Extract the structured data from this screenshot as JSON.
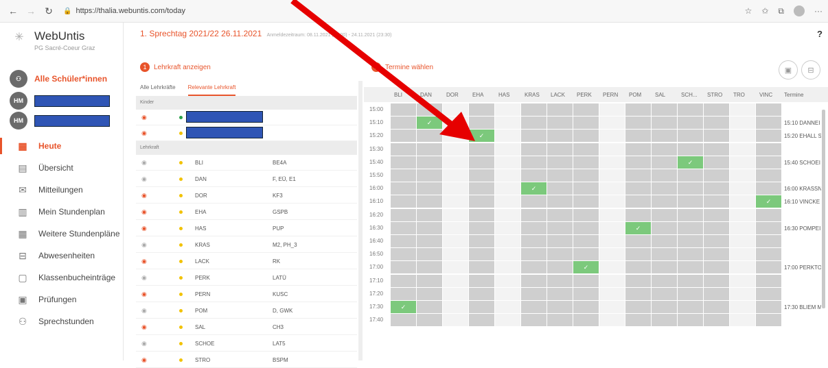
{
  "browser": {
    "url": "https://thalia.webuntis.com/today"
  },
  "app": {
    "brand": "WebUntis",
    "school": "PG Sacré-Coeur Graz"
  },
  "user": {
    "all_students": "Alle Schüler*innen",
    "initials": "HM"
  },
  "nav": [
    {
      "label": "Heute",
      "icon": "calendar-grid-icon",
      "glyph": "▦"
    },
    {
      "label": "Übersicht",
      "icon": "overview-icon",
      "glyph": "▤"
    },
    {
      "label": "Mitteilungen",
      "icon": "mail-icon",
      "glyph": "✉"
    },
    {
      "label": "Mein Stundenplan",
      "icon": "timetable-icon",
      "glyph": "▥"
    },
    {
      "label": "Weitere Stundenpläne",
      "icon": "timetables-icon",
      "glyph": "▦"
    },
    {
      "label": "Abwesenheiten",
      "icon": "absence-icon",
      "glyph": "⊟"
    },
    {
      "label": "Klassenbucheinträge",
      "icon": "classbook-icon",
      "glyph": "▢"
    },
    {
      "label": "Prüfungen",
      "icon": "exam-icon",
      "glyph": "▣"
    },
    {
      "label": "Sprechstunden",
      "icon": "consultation-icon",
      "glyph": "⚇"
    }
  ],
  "header": {
    "title": "1. Sprechtag 2021/22 26.11.2021",
    "subtitle": "Anmeldezeitraum: 08.11.2021 (00:00) - 24.11.2021 (23:30)"
  },
  "steps": {
    "step1": "Lehrkraft anzeigen",
    "step1_num": "1",
    "step2": "Termine wählen",
    "step2_num": "2"
  },
  "tabs": [
    "Alle Lehrkräfte",
    "Relevante Lehrkraft"
  ],
  "sections": {
    "kids": "Kinder",
    "teachers": "Lehrkraft"
  },
  "kids": [
    {
      "eye": "red",
      "dot": "green"
    },
    {
      "eye": "red",
      "dot": "yellow"
    }
  ],
  "teachers": [
    {
      "name": "BLI",
      "subject": "BE4A",
      "eye": "gray"
    },
    {
      "name": "DAN",
      "subject": "F, EÜ, E1",
      "eye": "gray"
    },
    {
      "name": "DOR",
      "subject": "KF3",
      "eye": "red"
    },
    {
      "name": "EHA",
      "subject": "GSPB",
      "eye": "red"
    },
    {
      "name": "HAS",
      "subject": "PUP",
      "eye": "red"
    },
    {
      "name": "KRAS",
      "subject": "M2, PH_3",
      "eye": "gray"
    },
    {
      "name": "LACK",
      "subject": "RK",
      "eye": "red"
    },
    {
      "name": "PERK",
      "subject": "LATÜ",
      "eye": "gray"
    },
    {
      "name": "PERN",
      "subject": "KUSC",
      "eye": "red"
    },
    {
      "name": "POM",
      "subject": "D, GWK",
      "eye": "gray"
    },
    {
      "name": "SAL",
      "subject": "CH3",
      "eye": "red"
    },
    {
      "name": "SCHOE",
      "subject": "LAT5",
      "eye": "gray"
    },
    {
      "name": "STRO",
      "subject": "BSPM",
      "eye": "red"
    }
  ],
  "grid": {
    "columns": [
      "BLI",
      "DAN",
      "DOR",
      "EHA",
      "HAS",
      "KRAS",
      "LACK",
      "PERK",
      "PERN",
      "POM",
      "SAL",
      "SCH...",
      "STRO",
      "TRO",
      "VINC"
    ],
    "termine_label": "Termine",
    "times": [
      "15:00",
      "15:10",
      "15:20",
      "15:30",
      "15:40",
      "15:50",
      "16:00",
      "16:10",
      "16:20",
      "16:30",
      "16:40",
      "16:50",
      "17:00",
      "17:10",
      "17:20",
      "17:30",
      "17:40"
    ],
    "booked": [
      {
        "time": "15:10",
        "col": 1
      },
      {
        "time": "15:20",
        "col": 3
      },
      {
        "time": "15:40",
        "col": 11
      },
      {
        "time": "16:00",
        "col": 5
      },
      {
        "time": "16:10",
        "col": 14
      },
      {
        "time": "16:30",
        "col": 9
      },
      {
        "time": "17:00",
        "col": 7
      },
      {
        "time": "17:30",
        "col": 0
      }
    ],
    "free_cols": [
      2,
      4,
      8,
      13
    ],
    "termine": [
      {
        "time": "15:10",
        "text": "15:10 DANNEI"
      },
      {
        "time": "15:20",
        "text": "15:20 EHALL S"
      },
      {
        "time": "15:40",
        "text": "15:40 SCHOEI"
      },
      {
        "time": "16:00",
        "text": "16:00 KRASSN"
      },
      {
        "time": "16:10",
        "text": "16:10 VINCKE"
      },
      {
        "time": "16:30",
        "text": "16:30 POMPEI"
      },
      {
        "time": "17:00",
        "text": "17:00 PERKTO"
      },
      {
        "time": "17:30",
        "text": "17:30 BLIEM M"
      }
    ]
  },
  "colors": {
    "accent": "#e8542b",
    "booked": "#7cc97c",
    "arrow": "#e60000"
  }
}
